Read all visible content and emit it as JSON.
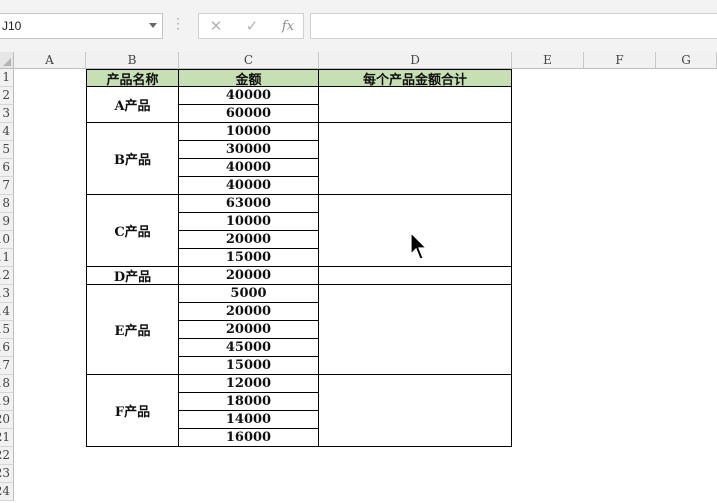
{
  "name_box": {
    "value": "J10"
  },
  "formula_bar": {
    "cancel_symbol": "✕",
    "enter_symbol": "✓",
    "fx_label": "fx",
    "formula": ""
  },
  "columns": [
    "A",
    "B",
    "C",
    "D",
    "E",
    "F",
    "G"
  ],
  "rows": [
    "1",
    "2",
    "3",
    "4",
    "5",
    "6",
    "7",
    "8",
    "9",
    "10",
    "11",
    "12",
    "13",
    "14",
    "15",
    "16",
    "17",
    "18",
    "19",
    "20",
    "21",
    "22",
    "23",
    "24"
  ],
  "table": {
    "headers": [
      "产品名称",
      "金额",
      "每个产品金额合计"
    ],
    "groups": [
      {
        "product": "A产品",
        "amounts": [
          "40000",
          "60000"
        ],
        "total": ""
      },
      {
        "product": "B产品",
        "amounts": [
          "10000",
          "30000",
          "40000",
          "40000"
        ],
        "total": ""
      },
      {
        "product": "C产品",
        "amounts": [
          "63000",
          "10000",
          "20000",
          "15000"
        ],
        "total": ""
      },
      {
        "product": "D产品",
        "amounts": [
          "20000"
        ],
        "total": ""
      },
      {
        "product": "E产品",
        "amounts": [
          "5000",
          "20000",
          "20000",
          "45000",
          "15000"
        ],
        "total": ""
      },
      {
        "product": "F产品",
        "amounts": [
          "12000",
          "18000",
          "14000",
          "16000"
        ],
        "total": ""
      }
    ]
  }
}
